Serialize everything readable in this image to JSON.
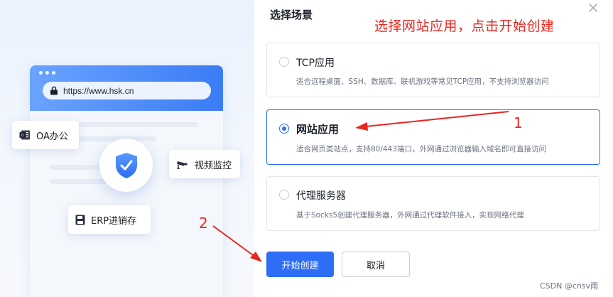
{
  "illustration": {
    "url": "https://www.hsk.cn",
    "chips": {
      "oa": "OA办公",
      "video": "视频监控",
      "erp": "ERP进销存"
    }
  },
  "dialog": {
    "title": "选择场景",
    "options": [
      {
        "title": "TCP应用",
        "desc": "适合远程桌面、SSH、数据库、联机游戏等常见TCP应用，不支持浏览器访问",
        "selected": false
      },
      {
        "title": "网站应用",
        "desc": "适合网页类站点，支持80/443端口，外网通过浏览器输入域名即可直接访问",
        "selected": true
      },
      {
        "title": "代理服务器",
        "desc": "基于Socks5创建代理服务器，外网通过代理软件接入，实现网络代理",
        "selected": false
      }
    ],
    "buttons": {
      "start": "开始创建",
      "cancel": "取消"
    }
  },
  "annotations": {
    "instruction": "选择网站应用，点击开始创建",
    "step1": "1",
    "step2": "2",
    "color": "#e8271d"
  },
  "watermark": "CSDN @cnsv雨",
  "colors": {
    "accent": "#2e6df6"
  }
}
